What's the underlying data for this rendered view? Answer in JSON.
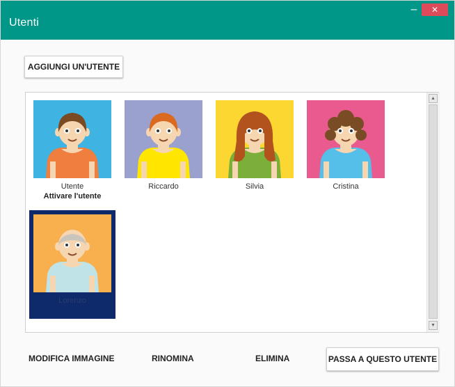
{
  "window": {
    "title": "Utenti",
    "minimize_glyph": "–",
    "close_glyph": "✕"
  },
  "toolbar": {
    "add_user_label": "AGGIUNGI UN'UTENTE"
  },
  "users": [
    {
      "name": "Utente",
      "subtitle": "Attivare l'utente",
      "bg": "#3fb3e1",
      "shirt": "#f07e3f",
      "hair": "#7a4a22"
    },
    {
      "name": "Riccardo",
      "subtitle": "",
      "bg": "#9aa1cf",
      "shirt": "#ffe600",
      "hair": "#d96a1f"
    },
    {
      "name": "Silvia",
      "subtitle": "",
      "bg": "#fcd732",
      "shirt": "#7cae3a",
      "hair": "#b2531e"
    },
    {
      "name": "Cristina",
      "subtitle": "",
      "bg": "#e95a8e",
      "shirt": "#55bfe9",
      "hair": "#7a4c25"
    },
    {
      "name": "Lorenzo",
      "subtitle": "",
      "bg": "#f7b04d",
      "shirt": "#bfe3e6",
      "hair": "#c9c4bc",
      "selected": true
    }
  ],
  "footer": {
    "edit_image_label": "MODIFICA IMMAGINE",
    "rename_label": "RINOMINA",
    "delete_label": "ELIMINA",
    "switch_user_label": "PASSA A QUESTO UTENTE"
  },
  "colors": {
    "titlebar": "#009688",
    "close": "#dd4b5b",
    "selection": "#0e2a6a"
  },
  "icons": {
    "minimize": "minimize-icon",
    "close": "close-icon",
    "scroll_up": "scroll-up-arrow-icon",
    "scroll_down": "scroll-down-arrow-icon"
  }
}
